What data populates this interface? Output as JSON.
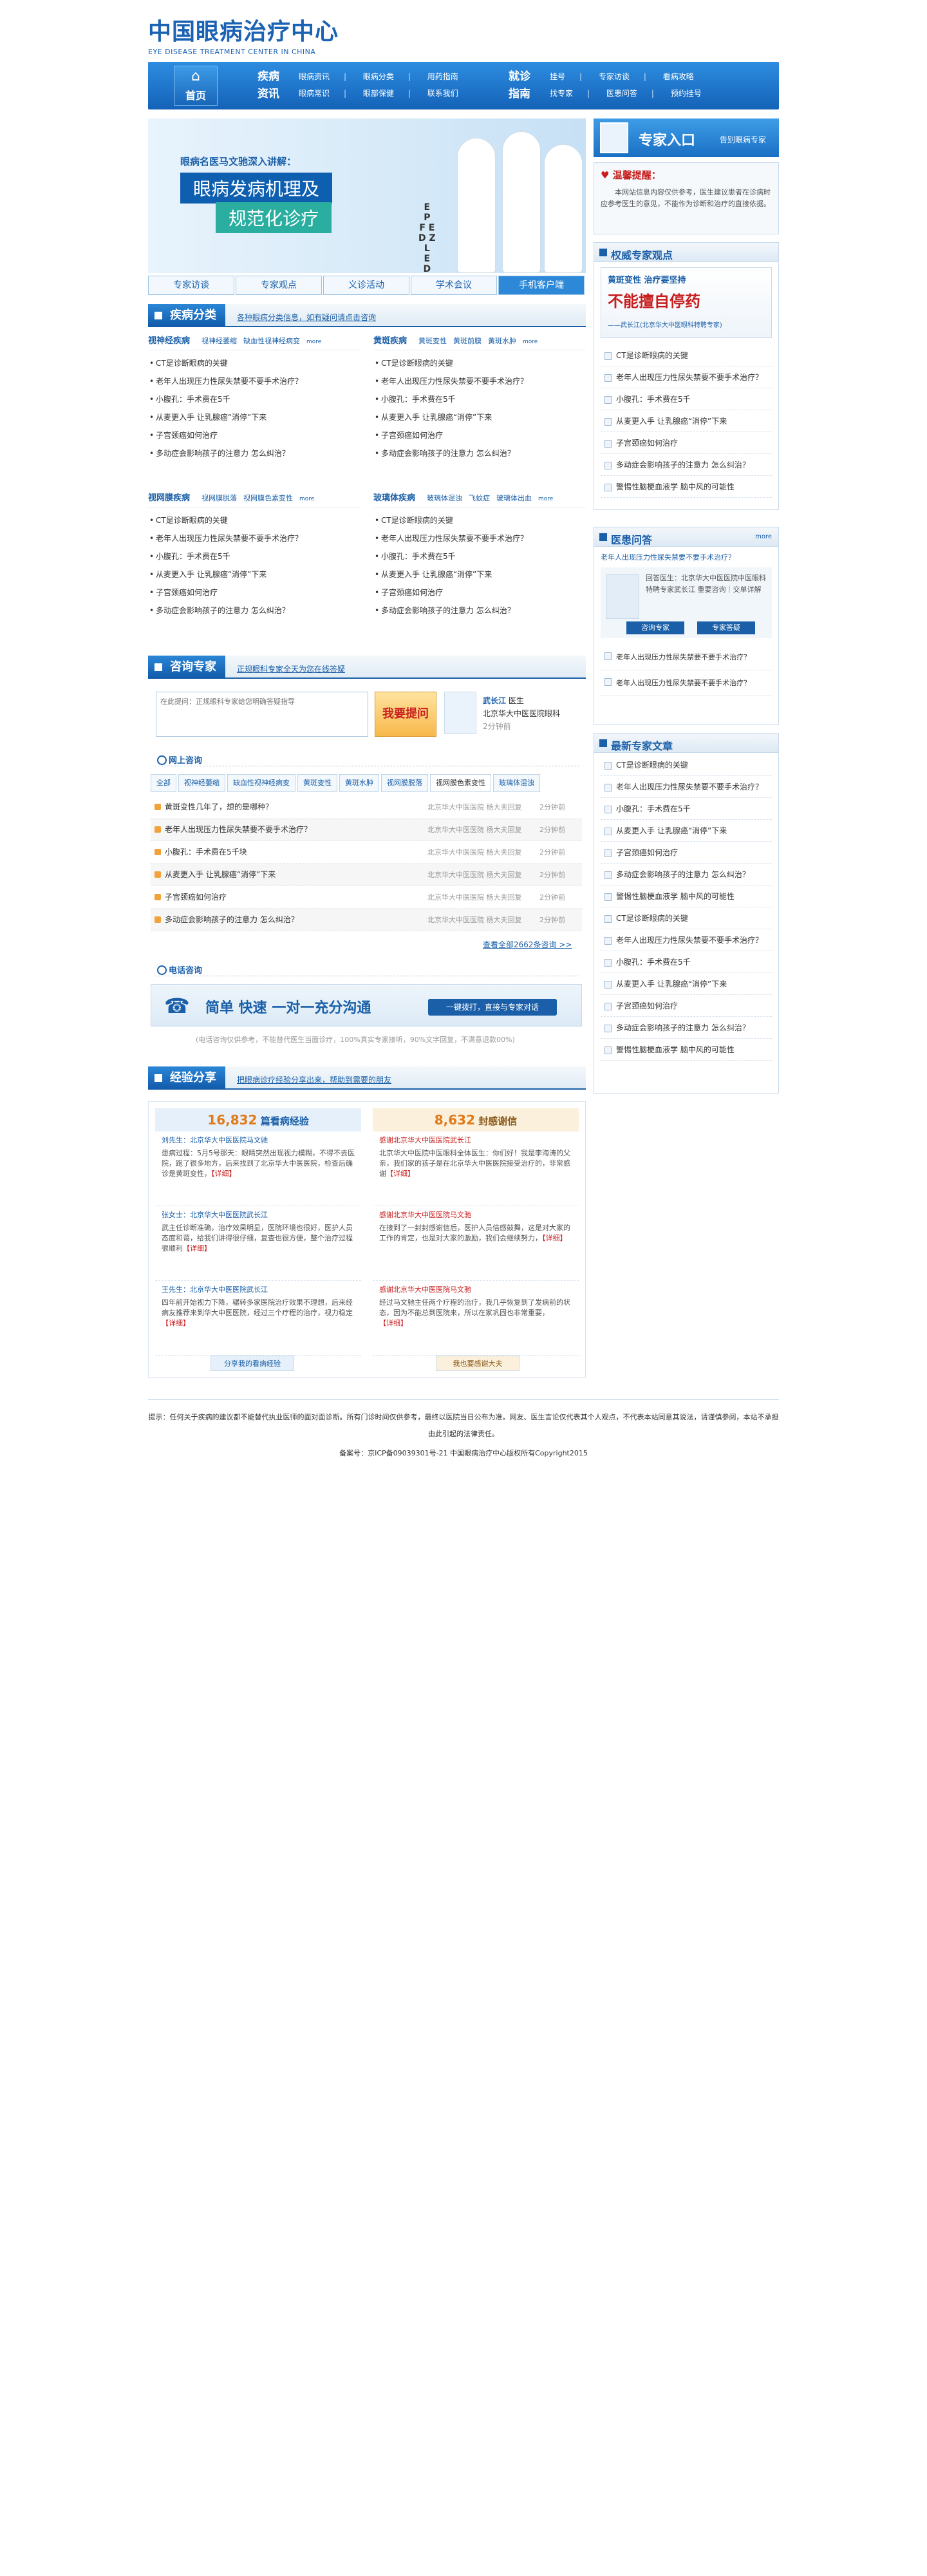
{
  "header": {
    "logo_cn": "中国眼病治疗中心",
    "logo_en": "EYE DISEASE TREATMENT CENTER IN CHINA"
  },
  "nav": {
    "home": "首页",
    "g1_title": "疾病资讯",
    "g1_row1": [
      "眼病资讯",
      "眼病分类",
      "用药指南"
    ],
    "g1_row2": [
      "眼病常识",
      "眼部保健",
      "联系我们"
    ],
    "g2_title": "就诊指南",
    "g2_row1": [
      "挂号",
      "专家访谈",
      "看病攻略"
    ],
    "g2_row2": [
      "找专家",
      "医患问答",
      "预约挂号"
    ]
  },
  "banner": {
    "intro": "眼病名医马文驰深入讲解：",
    "line1": "眼病发病机理及",
    "line2": "规范化诊疗",
    "chart": "E\nP\nF E\nD Z\nL\nE\nD"
  },
  "tabs": [
    "专家访谈",
    "专家观点",
    "义诊活动",
    "学术会议",
    "手机客户端"
  ],
  "sidebar": {
    "expert_title": "专家入口",
    "expert_sub": "告别眼病专家",
    "remind_title": "温馨提醒：",
    "remind_text": "本网站信息内容仅供参考，医生建议患者在诊病时应参考医生的意见，不能作为诊断和治疗的直接依据。",
    "authority_title": "权威专家观点",
    "authority_img_tag": "黄斑变性 治疗要坚持",
    "authority_img_big": "不能擅自停药",
    "authority_img_by": "——武长江(北京华大中医眼科特聘专家)",
    "authority_list": [
      "CT是诊断眼病的关键",
      "老年人出现压力性尿失禁要不要手术治疗？",
      "小腹孔：手术费在5千",
      "从麦更入手 让乳腺癌“消停”下来",
      "子宫颈癌如何治疗",
      "多动症会影响孩子的注意力 怎么纠治？",
      "警惕性脑梗血液学 脑中风的可能性"
    ],
    "qa_title": "医患问答",
    "qa_more": "more",
    "qa_q": "老年人出现压力性尿失禁要不要手术治疗？",
    "qa_answer": "回答医生：北京华大中医医院中医眼科特聘专家武长江 重要咨询｜交单详解",
    "qa_btn1": "咨询专家",
    "qa_btn2": "专家答疑",
    "qa_list": [
      "老年人出现压力性尿失禁要不要手术治疗？",
      "老年人出现压力性尿失禁要不要手术治疗？"
    ],
    "latest_title": "最新专家文章",
    "latest_list": [
      "CT是诊断眼病的关键",
      "老年人出现压力性尿失禁要不要手术治疗？",
      "小腹孔：手术费在5千",
      "从麦更入手 让乳腺癌“消停”下来",
      "子宫颈癌如何治疗",
      "多动症会影响孩子的注意力 怎么纠治？",
      "警惕性脑梗血液学 脑中风的可能性",
      "CT是诊断眼病的关键",
      "老年人出现压力性尿失禁要不要手术治疗？",
      "小腹孔：手术费在5千",
      "从麦更入手 让乳腺癌“消停”下来",
      "子宫颈癌如何治疗",
      "多动症会影响孩子的注意力 怎么纠治？",
      "警惕性脑梗血液学 脑中风的可能性"
    ]
  },
  "disease": {
    "label": "疾病分类",
    "sub": "各种眼病分类信息，如有疑问请点击咨询",
    "blocks": [
      {
        "title": "视神经疾病",
        "links": [
          "视神经萎缩",
          "缺血性视神经病变"
        ],
        "more": "more",
        "items": [
          "CT是诊断眼病的关键",
          "老年人出现压力性尿失禁要不要手术治疗？",
          "小腹孔：手术费在5千",
          "从麦更入手 让乳腺癌“消停”下来",
          "子宫颈癌如何治疗",
          "多动症会影响孩子的注意力 怎么纠治？"
        ]
      },
      {
        "title": "黄斑疾病",
        "links": [
          "黄斑变性",
          "黄斑前膜",
          "黄斑水肿"
        ],
        "more": "more",
        "items": [
          "CT是诊断眼病的关键",
          "老年人出现压力性尿失禁要不要手术治疗？",
          "小腹孔：手术费在5千",
          "从麦更入手 让乳腺癌“消停”下来",
          "子宫颈癌如何治疗",
          "多动症会影响孩子的注意力 怎么纠治？"
        ]
      },
      {
        "title": "视网膜疾病",
        "links": [
          "视网膜脱落",
          "视网膜色素变性"
        ],
        "more": "more",
        "items": [
          "CT是诊断眼病的关键",
          "老年人出现压力性尿失禁要不要手术治疗？",
          "小腹孔：手术费在5千",
          "从麦更入手 让乳腺癌“消停”下来",
          "子宫颈癌如何治疗",
          "多动症会影响孩子的注意力 怎么纠治？"
        ]
      },
      {
        "title": "玻璃体疾病",
        "links": [
          "玻璃体混浊",
          "飞蚊症",
          "玻璃体出血"
        ],
        "more": "more",
        "items": [
          "CT是诊断眼病的关键",
          "老年人出现压力性尿失禁要不要手术治疗？",
          "小腹孔：手术费在5千",
          "从麦更入手 让乳腺癌“消停”下来",
          "子宫颈癌如何治疗",
          "多动症会影响孩子的注意力 怎么纠治？"
        ]
      }
    ]
  },
  "consult": {
    "label": "咨询专家",
    "sub": "正规眼科专家全天为您在线答疑",
    "placeholder": "在此提问：正规眼科专家给您明确答疑指导",
    "ask_btn": "我要提问",
    "doc_name": "武长江",
    "doc_role": "医生",
    "doc_line1": "北京华大中医医院眼科",
    "doc_line2": "2分钟前",
    "online_title": "网上咨询",
    "ftabs": [
      "全部",
      "视神经萎缩",
      "缺血性视神经病变",
      "黄斑变性",
      "黄斑水肿",
      "视网膜脱落",
      "视网膜色素变性",
      "玻璃体混浊"
    ],
    "rows": [
      {
        "q": "黄斑变性几年了，想的是哪种？",
        "doc": "北京华大中医医院 杨大夫回复",
        "t": "2分钟前"
      },
      {
        "q": "老年人出现压力性尿失禁要不要手术治疗？",
        "doc": "北京华大中医医院 杨大夫回复",
        "t": "2分钟前"
      },
      {
        "q": "小腹孔：手术费在5千块",
        "doc": "北京华大中医医院 杨大夫回复",
        "t": "2分钟前"
      },
      {
        "q": "从麦更入手 让乳腺癌“消停”下来",
        "doc": "北京华大中医医院 杨大夫回复",
        "t": "2分钟前"
      },
      {
        "q": "子宫颈癌如何治疗",
        "doc": "北京华大中医医院 杨大夫回复",
        "t": "2分钟前"
      },
      {
        "q": "多动症会影响孩子的注意力 怎么纠治？",
        "doc": "北京华大中医医院 杨大夫回复",
        "t": "2分钟前"
      }
    ],
    "more": "查看全部2662条咨询 >>",
    "phone_title": "电话咨询",
    "phone_slogan": "简单  快速  一对一充分沟通",
    "phone_btn": "一键拨打，直接与专家对话",
    "phone_note": "(电话咨询仅供参考，不能替代医生当面诊疗，100%真实专家接听，90%文字回复，不满意退款00%)"
  },
  "share": {
    "label": "经验分享",
    "sub": "把眼病诊疗经验分享出来，帮助到需要的朋友",
    "left_count": "16,832",
    "left_label": "篇看病经验",
    "right_count": "8,632",
    "right_label": "封感谢信",
    "left_items": [
      {
        "who": "刘先生：北京华大中医医院马文驰",
        "body": "患病过程：5月5号那天：眼睛突然出现视力模糊，不得不去医院，跑了很多地方，后来找到了北京华大中医医院，检查后确诊是黄斑变性，",
        "det": "【详细】"
      },
      {
        "who": "张女士：北京华大中医医院武长江",
        "body": "武主任诊断准确，治疗效果明显，医院环境也很好，医护人员态度和蔼，给我们讲得很仔细，复查也很方便，整个治疗过程很顺利",
        "det": "【详细】"
      },
      {
        "who": "王先生：北京华大中医医院武长江",
        "body": "四年前开始视力下降，辗转多家医院治疗效果不理想，后来经病友推荐来到华大中医医院，经过三个疗程的治疗，视力稳定",
        "det": "【详细】"
      }
    ],
    "right_items": [
      {
        "who": "感谢北京华大中医医院武长江",
        "body": "北京华大中医院中医眼科全体医生：你们好！我是李海涛的父亲，我们家的孩子是在北京华大中医医院接受治疗的，非常感谢",
        "det": "【详细】"
      },
      {
        "who": "感谢北京华大中医医院马文驰",
        "body": "在接到了一封封感谢信后，医护人员倍感鼓舞，这是对大家的工作的肯定，也是对大家的激励，我们会继续努力，",
        "det": "【详细】"
      },
      {
        "who": "感谢北京华大中医医院马文驰",
        "body": "经过马文驰主任两个疗程的治疗，我几乎恢复到了发病前的状态，因为不能总到医院来，所以在家巩固也非常重要，",
        "det": "【详细】"
      }
    ],
    "left_btn": "分享我的看病经验",
    "right_btn": "我也要感谢大夫"
  },
  "footer": {
    "line1": "提示：任何关于疾病的建议都不能替代执业医师的面对面诊断。所有门诊时间仅供参考，最终以医院当日公布为准。网友、医生言论仅代表其个人观点，不代表本站同意其说法，请谨慎参阅，本站不承担由此引起的法律责任。",
    "line2": "备案号：京ICP备09039301号-21 中国眼病治疗中心版权所有Copyright2015"
  }
}
